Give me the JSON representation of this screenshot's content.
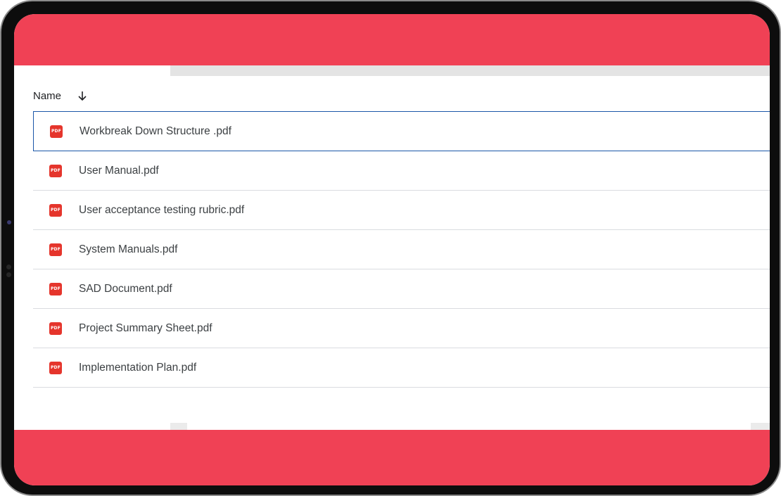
{
  "colors": {
    "brand_band": "#f04155",
    "pdf_icon": "#e5352c",
    "selection_border": "#1a56a8"
  },
  "file_list": {
    "header": {
      "name_label": "Name",
      "sort_icon": "arrow-down-icon"
    },
    "icon_text": "PDF",
    "files": [
      {
        "name": "Workbreak Down Structure .pdf",
        "selected": true
      },
      {
        "name": "User Manual.pdf",
        "selected": false
      },
      {
        "name": "User acceptance testing rubric.pdf",
        "selected": false
      },
      {
        "name": "System Manuals.pdf",
        "selected": false
      },
      {
        "name": "SAD Document.pdf",
        "selected": false
      },
      {
        "name": "Project Summary Sheet.pdf",
        "selected": false
      },
      {
        "name": "Implementation Plan.pdf",
        "selected": false
      }
    ]
  }
}
